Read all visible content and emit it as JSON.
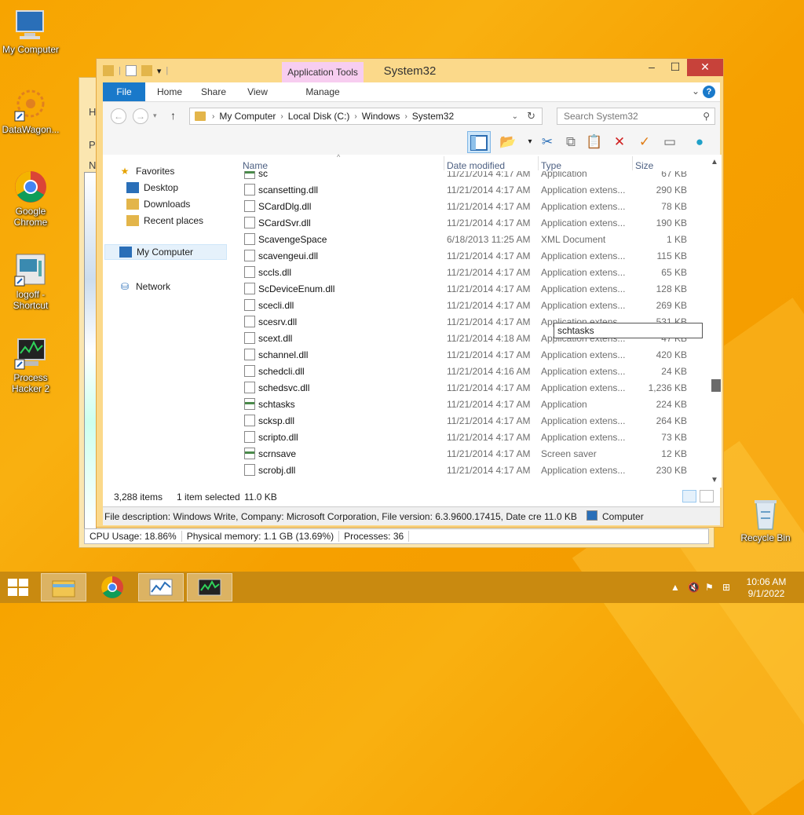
{
  "desktop": {
    "icons": [
      {
        "label": "My Computer"
      },
      {
        "label": "DataWagon..."
      },
      {
        "label": "Google Chrome"
      },
      {
        "label": "logoff - Shortcut"
      },
      {
        "label": "Process Hacker 2"
      },
      {
        "label": "Recycle Bin"
      }
    ]
  },
  "backwin": {
    "status": [
      "CPU Usage: 18.86%",
      "Physical memory: 1.1 GB (13.69%)",
      "Processes: 36"
    ],
    "side_letters": [
      "H",
      "P",
      "N"
    ]
  },
  "window": {
    "title": "System32",
    "context_tab": "Application Tools",
    "tabs": [
      "File",
      "Home",
      "Share",
      "View",
      "Manage"
    ],
    "breadcrumb": [
      "My Computer",
      "Local Disk (C:)",
      "Windows",
      "System32"
    ],
    "search_placeholder": "Search System32",
    "help": "?",
    "close": "✕",
    "minimize": "–",
    "maximize": "☐"
  },
  "navpane": {
    "favorites": "Favorites",
    "desktop": "Desktop",
    "downloads": "Downloads",
    "recent": "Recent places",
    "computer": "My Computer",
    "network": "Network"
  },
  "columns": {
    "name": "Name",
    "date": "Date modified",
    "type": "Type",
    "size": "Size"
  },
  "files": [
    {
      "name": "sc",
      "date": "11/21/2014 4:17 AM",
      "type": "Application",
      "size": "67 KB",
      "icon": "app"
    },
    {
      "name": "scansetting.dll",
      "date": "11/21/2014 4:17 AM",
      "type": "Application extens...",
      "size": "290 KB",
      "icon": "dll"
    },
    {
      "name": "SCardDlg.dll",
      "date": "11/21/2014 4:17 AM",
      "type": "Application extens...",
      "size": "78 KB",
      "icon": "dll"
    },
    {
      "name": "SCardSvr.dll",
      "date": "11/21/2014 4:17 AM",
      "type": "Application extens...",
      "size": "190 KB",
      "icon": "dll"
    },
    {
      "name": "ScavengeSpace",
      "date": "6/18/2013 11:25 AM",
      "type": "XML Document",
      "size": "1 KB",
      "icon": "xml"
    },
    {
      "name": "scavengeui.dll",
      "date": "11/21/2014 4:17 AM",
      "type": "Application extens...",
      "size": "115 KB",
      "icon": "dll"
    },
    {
      "name": "sccls.dll",
      "date": "11/21/2014 4:17 AM",
      "type": "Application extens...",
      "size": "65 KB",
      "icon": "dll"
    },
    {
      "name": "ScDeviceEnum.dll",
      "date": "11/21/2014 4:17 AM",
      "type": "Application extens...",
      "size": "128 KB",
      "icon": "dll"
    },
    {
      "name": "scecli.dll",
      "date": "11/21/2014 4:17 AM",
      "type": "Application extens...",
      "size": "269 KB",
      "icon": "dll"
    },
    {
      "name": "scesrv.dll",
      "date": "11/21/2014 4:17 AM",
      "type": "Application extens...",
      "size": "531 KB",
      "icon": "dll"
    },
    {
      "name": "scext.dll",
      "date": "11/21/2014 4:18 AM",
      "type": "Application extens...",
      "size": "47 KB",
      "icon": "dll"
    },
    {
      "name": "schannel.dll",
      "date": "11/21/2014 4:17 AM",
      "type": "Application extens...",
      "size": "420 KB",
      "icon": "dll"
    },
    {
      "name": "schedcli.dll",
      "date": "11/21/2014 4:16 AM",
      "type": "Application extens...",
      "size": "24 KB",
      "icon": "dll"
    },
    {
      "name": "schedsvc.dll",
      "date": "11/21/2014 4:17 AM",
      "type": "Application extens...",
      "size": "1,236 KB",
      "icon": "dll"
    },
    {
      "name": "schtasks",
      "date": "11/21/2014 4:17 AM",
      "type": "Application",
      "size": "224 KB",
      "icon": "app"
    },
    {
      "name": "scksp.dll",
      "date": "11/21/2014 4:17 AM",
      "type": "Application extens...",
      "size": "264 KB",
      "icon": "dll"
    },
    {
      "name": "scripto.dll",
      "date": "11/21/2014 4:17 AM",
      "type": "Application extens...",
      "size": "73 KB",
      "icon": "dll"
    },
    {
      "name": "scrnsave",
      "date": "11/21/2014 4:17 AM",
      "type": "Screen saver",
      "size": "12 KB",
      "icon": "app"
    },
    {
      "name": "scrobj.dll",
      "date": "11/21/2014 4:17 AM",
      "type": "Application extens...",
      "size": "230 KB",
      "icon": "dll"
    }
  ],
  "rename_value": "schtasks",
  "status": {
    "items": "3,288 items",
    "selected": "1 item selected",
    "size": "11.0 KB"
  },
  "descbar": {
    "desc": "File description: Windows Write, Company: Microsoft Corporation, File version: 6.3.9600.17415, Date cre 11.0 KB",
    "computer": "Computer"
  },
  "taskbar": {
    "time": "10:06 AM",
    "date": "9/1/2022"
  },
  "colors": {
    "file_tab": "#1979ca",
    "context_tab": "#f7cdf0",
    "close": "#c7423a",
    "taskbar": "#c98a10"
  }
}
